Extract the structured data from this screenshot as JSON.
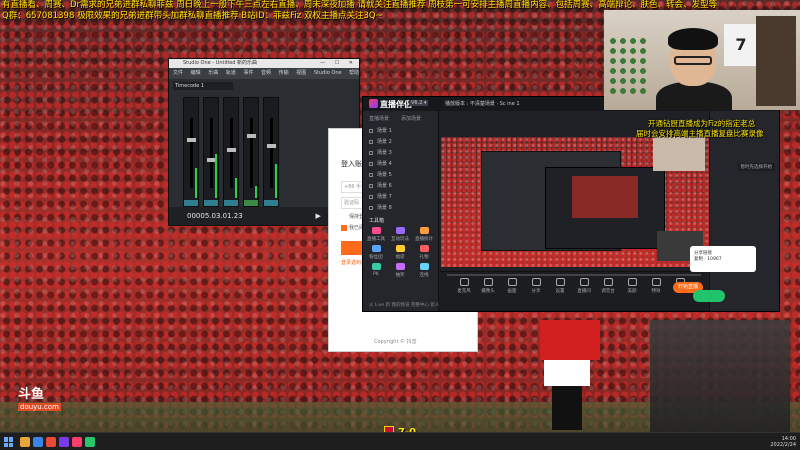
{
  "ticker": {
    "line1": "有直播看、周赛、Dr需求的兄弟进群私聊菲兹        周日晚上一般下午三点左右直播、周末深夜加播 请就关注直播推荐       周枝第一可安排主播周直播内容、包括周赛、高端辩论、肤色、转会、发型等",
    "line2": "Q群：657081398 极限效果的兄弟进群带头加群私聊直播推荐        B站ID：菲兹Fiz        双权主播点关注3Q~"
  },
  "studio": {
    "title": "Studio One - Untitled 新的乐曲",
    "menu": [
      "文件",
      "编辑",
      "乐曲",
      "轨道",
      "事件",
      "音频",
      "传输",
      "视图",
      "Studio One",
      "帮助"
    ],
    "track": "Timecode 1",
    "timecode": "00005.03.01.23",
    "controls": "▶ ■ ●"
  },
  "login": {
    "title": "登入账号",
    "field1": "+86 手机号",
    "field2": "验证码",
    "remember": "保持登录",
    "agree": "我已阅读并同意",
    "link": "登录遇到问题",
    "foot": "Copyright © 抖音"
  },
  "obs": {
    "app": "直播伴侣",
    "version": "V6.2 ▾",
    "scene_title": "播放版本 : 不清楚场景 · Sc ine 1",
    "side_tabs": [
      "直播场景",
      "添加场景"
    ],
    "scenes": [
      "场景 1",
      "场景 2",
      "场景 3",
      "场景 4",
      "场景 5",
      "场景 6",
      "场景 7",
      "场景 8"
    ],
    "tools_title": "工具箱",
    "tools": [
      "直播工具",
      "互动玩法",
      "直播统计",
      "粉丝团",
      "福袋",
      "礼物",
      "PK",
      "抽奖",
      "连线"
    ],
    "side_bottom": "火 Live 新 我的频道   完整中心   新人帮助",
    "bottom_buttons": [
      "麦克风",
      "摄像头",
      "画面",
      "分享",
      "设置",
      "直播间",
      "调音台",
      "美颜",
      "特效",
      "更多"
    ],
    "start_label": "开始直播",
    "notice": "暂时先选择开始"
  },
  "right_card": {
    "line1": "分享链接",
    "line2": "复制 · 10967"
  },
  "overlay": {
    "line1": "开通钻厨直播成为Fiz的指定老总",
    "line2": "届时会安排高端主播直播复盘比赛录像"
  },
  "cam": {
    "jersey": "7"
  },
  "brand": {
    "line1": "斗鱼",
    "line2": "douyu.com"
  },
  "score": "7-0",
  "taskbar": {
    "time": "14:00",
    "date": "2022/2/24"
  },
  "colors": {
    "accent_orange": "#ff6b1a",
    "green": "#21c46c",
    "ticker_yellow": "#ffe600"
  }
}
